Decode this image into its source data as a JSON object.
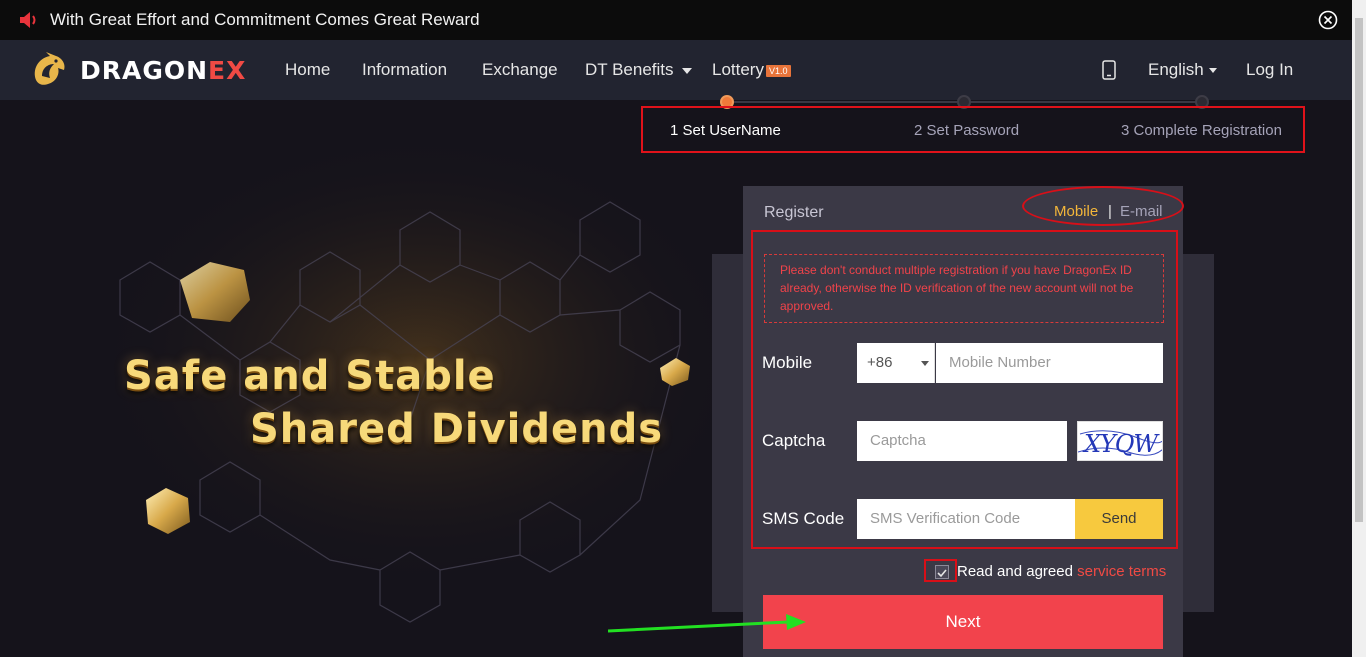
{
  "announcement": {
    "text": "With Great Effort and Commitment Comes Great Reward",
    "icons": [
      "speaker-icon",
      "close-circle-icon"
    ]
  },
  "nav": {
    "logo_main": "DRAGON",
    "logo_accent": "EX",
    "home": "Home",
    "information": "Information",
    "exchange": "Exchange",
    "dt_benefits": "DT Benefits",
    "lottery": "Lottery",
    "lottery_badge": "V1.0",
    "language": "English",
    "login": "Log In",
    "icons": [
      "dragon-logo-icon",
      "mobile-phone-icon",
      "chevron-down-icon"
    ]
  },
  "steps": [
    {
      "label": "1 Set UserName",
      "active": true
    },
    {
      "label": "2 Set Password",
      "active": false
    },
    {
      "label": "3 Complete Registration",
      "active": false
    }
  ],
  "hero": {
    "line1": "Safe and Stable",
    "line2": "Shared Dividends"
  },
  "form": {
    "title": "Register",
    "method_mobile": "Mobile",
    "method_separator": "|",
    "method_email": "E-mail",
    "notice": "Please don't conduct multiple registration if you have DragonEx ID already, otherwise the ID verification of the new account will not be approved.",
    "mobile_label": "Mobile",
    "country_code": "+86",
    "mobile_placeholder": "Mobile Number",
    "captcha_label": "Captcha",
    "captcha_placeholder": "Captcha",
    "captcha_image_text": "XYQW",
    "sms_label": "SMS Code",
    "sms_placeholder": "SMS Verification Code",
    "send_label": "Send",
    "agree_text": "Read and agreed",
    "terms_link": "service terms",
    "agree_checked": true,
    "next_label": "Next"
  },
  "colors": {
    "accent_red": "#f2434c",
    "brand_gold": "#f3b63a",
    "send_yellow": "#f7c93e",
    "annotation_red": "#d80f18",
    "annotation_green": "#22e022"
  }
}
